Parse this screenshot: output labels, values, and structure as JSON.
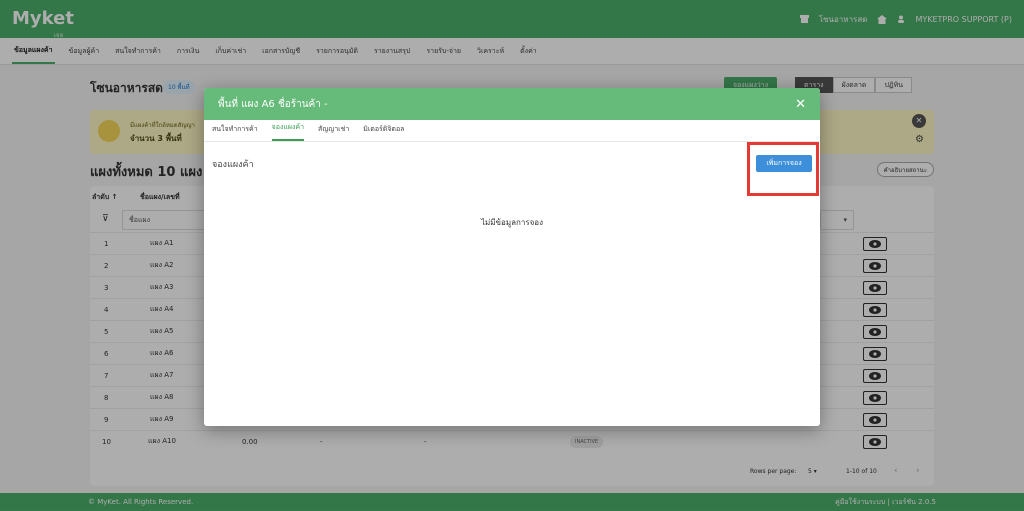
{
  "app": {
    "logo": "Myket",
    "logo_sub": "เจอ"
  },
  "topbar": {
    "zone_label": "โซนอาหารสด",
    "user_label": "MYKETPRO SUPPORT (P)"
  },
  "nav": [
    "ข้อมูลแผงค้า",
    "ข้อมูลผู้ค้า",
    "สนใจทำการค้า",
    "การเงิน",
    "เก็บค่าเช่า",
    "เอกสารบัญชี",
    "รายการอนุมัติ",
    "รายงานสรุป",
    "รายรับ-จ่าย",
    "วิเคราะห์",
    "ตั้งค่า"
  ],
  "page": {
    "title": "โซนอาหารสด",
    "badge": "10 พื้นที่",
    "btn_book": "จองแผงว่าง",
    "view_buttons": [
      "ตาราง",
      "ผังตลาด",
      "ปฏิทิน"
    ],
    "alert_line1": "มีแผงค้าที่ใกล้หมดสัญญา",
    "alert_line2": "จำนวน 3 พื้นที่",
    "stalls_title": "แผงทั้งหมด 10 แผง",
    "help": "คำอธิบายสถานะ"
  },
  "table": {
    "headers": [
      "ลำดับ",
      "ชื่อแผง/เลขที่"
    ],
    "filter_placeholder": "ชื่อแผง",
    "rows": [
      {
        "no": "1",
        "name": "แผง A1"
      },
      {
        "no": "2",
        "name": "แผง A2"
      },
      {
        "no": "3",
        "name": "แผง A3"
      },
      {
        "no": "4",
        "name": "แผง A4"
      },
      {
        "no": "5",
        "name": "แผง A5"
      },
      {
        "no": "6",
        "name": "แผง A6"
      },
      {
        "no": "7",
        "name": "แผง A7"
      },
      {
        "no": "8",
        "name": "แผง A8"
      },
      {
        "no": "9",
        "name": "แผง A9"
      },
      {
        "no": "10",
        "name": "แผง A10",
        "amount": "0.00",
        "col3": "-",
        "col4": "-",
        "status": "INACTIVE"
      }
    ],
    "rows_per_page_label": "Rows per page:",
    "rows_per_page": "5",
    "range": "1-10 of 10"
  },
  "footer": {
    "left": "© MyKet. All Rights Reserved.",
    "right": "คู่มือใช้งานระบบ | เวอร์ชัน 2.0.5"
  },
  "modal": {
    "title": "พื้นที่ แผง A6 ชื่อร้านค้า -",
    "tabs": [
      "สนใจทำการค้า",
      "จองแผงค้า",
      "สัญญาเช่า",
      "มิเตอร์ดิจิตอล"
    ],
    "active_tab": 1,
    "section_title": "จองแผงค้า",
    "add_button": "เพิ่มการจอง",
    "empty_message": "ไม่มีข้อมูลการจอง"
  },
  "colors": {
    "brand": "#4caf6a",
    "modal_header": "#66bb7a",
    "primary_button": "#3d8fd9",
    "highlight": "#e53935"
  }
}
